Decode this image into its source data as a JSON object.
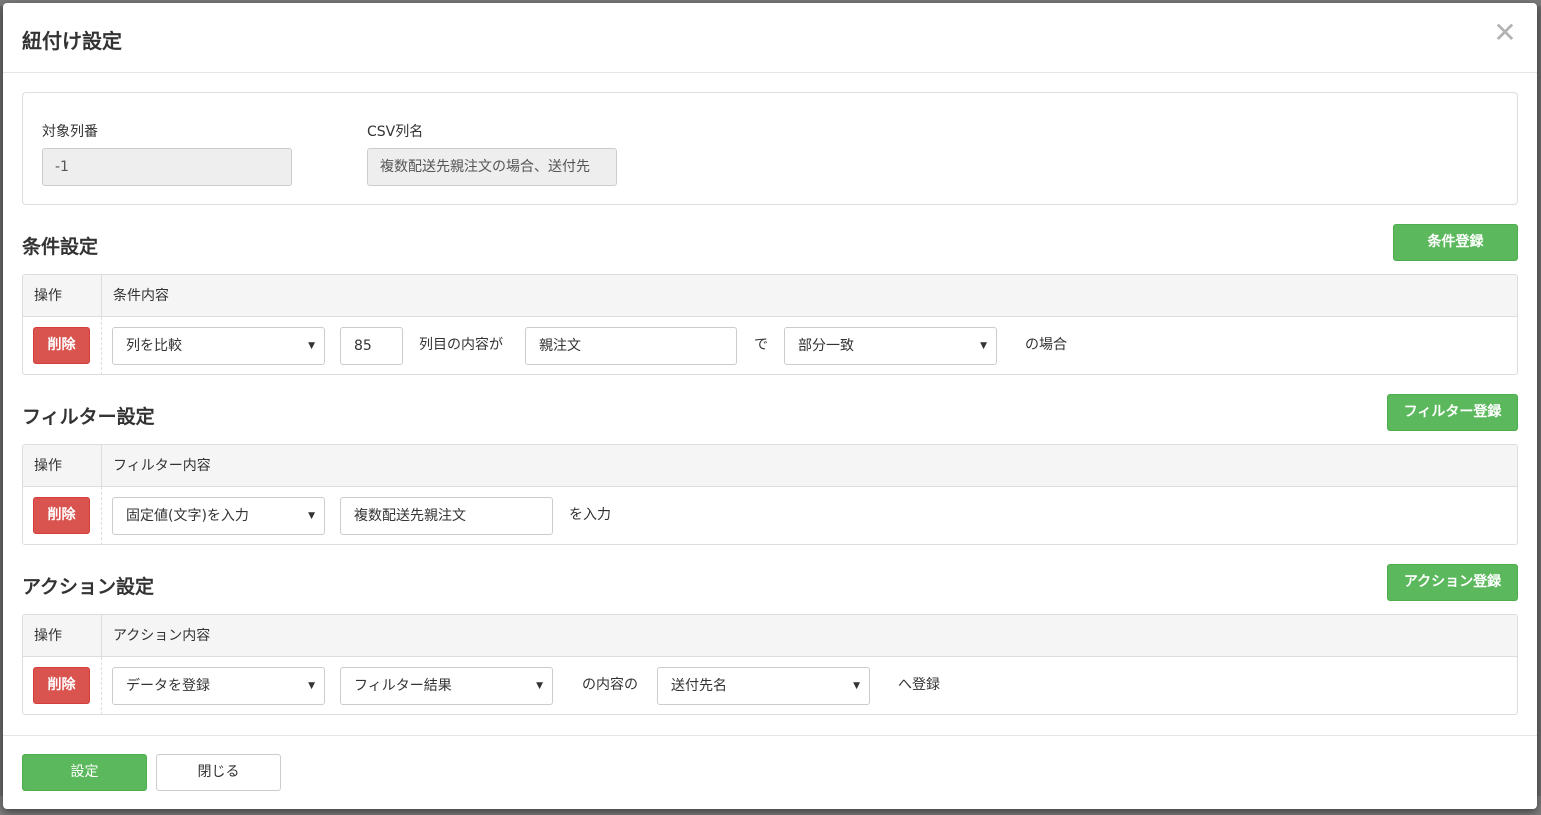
{
  "modal": {
    "title": "紐付け設定",
    "close_icon": "close-icon",
    "close_glyph": "✕"
  },
  "info": {
    "target_col_label": "対象列番",
    "target_col_value": "-1",
    "csv_col_label": "CSV列名",
    "csv_col_value": "複数配送先親注文の場合、送付先"
  },
  "conditions": {
    "title": "条件設定",
    "add_button": "条件登録",
    "header_op": "操作",
    "header_content": "条件内容",
    "row": {
      "delete_label": "削除",
      "type_select": "列を比較",
      "column_number": "85",
      "text_1": "列目の内容が",
      "match_value": "親注文",
      "text_2": "で",
      "match_mode_select": "部分一致",
      "text_3": "の場合"
    }
  },
  "filters": {
    "title": "フィルター設定",
    "add_button": "フィルター登録",
    "header_op": "操作",
    "header_content": "フィルター内容",
    "row": {
      "delete_label": "削除",
      "type_select": "固定値(文字)を入力",
      "value": "複数配送先親注文",
      "text_1": "を入力"
    }
  },
  "actions": {
    "title": "アクション設定",
    "add_button": "アクション登録",
    "header_op": "操作",
    "header_content": "アクション内容",
    "row": {
      "delete_label": "削除",
      "type_select": "データを登録",
      "source_select": "フィルター結果",
      "text_1": "の内容の",
      "target_select": "送付先名",
      "text_2": "へ登録"
    }
  },
  "footer": {
    "submit_label": "設定",
    "close_label": "閉じる"
  },
  "colors": {
    "success": "#5cb85c",
    "danger": "#d9534f",
    "readonly_bg": "#eeeeee"
  }
}
